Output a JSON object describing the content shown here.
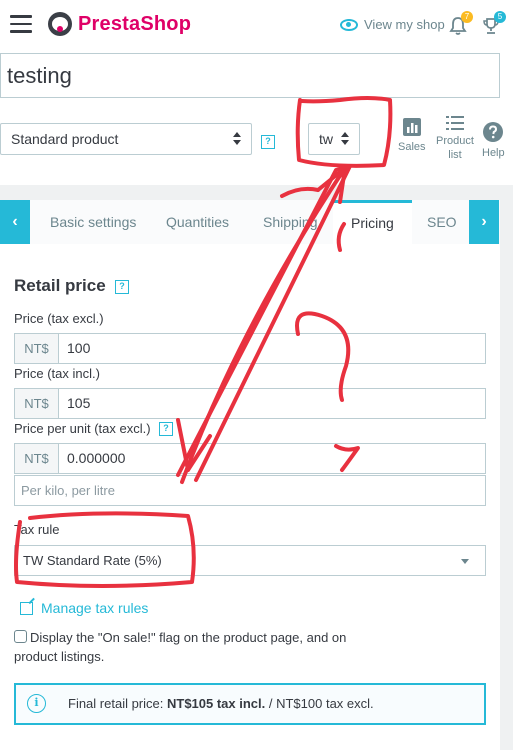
{
  "colors": {
    "accent": "#25b9d7",
    "brand": "#df0067",
    "annotation": "#e8313f",
    "text": "#363a41",
    "muted": "#6c868e"
  },
  "header": {
    "logo_text": "PrestaShop",
    "view_shop_label": "View my shop",
    "notifications": [
      {
        "icon": "bell-icon",
        "count": "7",
        "color": "#fbbb22"
      },
      {
        "icon": "trophy-icon",
        "count": "5",
        "color": "#25b9d7"
      }
    ]
  },
  "product": {
    "name": "testing",
    "type_label": "Standard product",
    "language": "tw"
  },
  "toolbar": {
    "sales_label": "Sales",
    "product_list_label_1": "Product",
    "product_list_label_2": "list",
    "help_label": "Help"
  },
  "tabs": {
    "items": [
      {
        "label": "Basic settings"
      },
      {
        "label": "Quantities"
      },
      {
        "label": "Shipping"
      },
      {
        "label": "Pricing"
      },
      {
        "label": "SEO"
      }
    ],
    "active": "Pricing"
  },
  "pricing": {
    "section_title": "Retail price",
    "help_glyph": "?",
    "price_excl_label": "Price (tax excl.)",
    "price_excl_currency": "NT$",
    "price_excl_value": "100",
    "price_incl_label": "Price (tax incl.)",
    "price_incl_currency": "NT$",
    "price_incl_value": "105",
    "unit_price_label": "Price per unit (tax excl.)",
    "unit_price_currency": "NT$",
    "unit_price_value": "0.000000",
    "unit_placeholder": "Per kilo, per litre",
    "tax_rule_label": "Tax rule",
    "tax_rule_value": "TW Standard Rate (5%)",
    "manage_tax_label": "Manage tax rules",
    "on_sale_label": "Display the \"On sale!\" flag on the product page, and on product listings.",
    "on_sale_checked": false,
    "final_price_prefix": "Final retail price: ",
    "final_price_incl": "NT$105 tax incl.",
    "final_price_suffix": " / NT$100 tax excl."
  },
  "icons": {
    "info_glyph": "i",
    "tab_prev_glyph": "‹",
    "tab_next_glyph": "›"
  }
}
